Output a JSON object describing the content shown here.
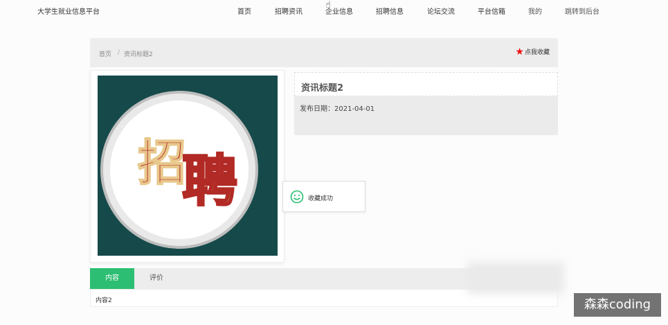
{
  "site": {
    "brand": "大学生就业信息平台"
  },
  "nav": {
    "items": [
      "首页",
      "招聘资讯",
      "企业信息",
      "招聘信息",
      "论坛交流",
      "平台信箱",
      "我的",
      "跳转到后台"
    ]
  },
  "breadcrumb": {
    "home": "首页",
    "separator": "/",
    "current": "资讯标题2"
  },
  "favorite": {
    "label": "点我收藏"
  },
  "poster": {
    "glyph1": "招",
    "glyph2": "聘"
  },
  "detail": {
    "title": "资讯标题2",
    "date_label": "发布日期：",
    "date": "2021-04-01"
  },
  "toast": {
    "message": "收藏成功"
  },
  "tabs": [
    {
      "label": "内容"
    },
    {
      "label": "评价"
    }
  ],
  "content": {
    "text": "内容2"
  },
  "watermark": {
    "text": "森森coding"
  },
  "colors": {
    "accent": "#2cbe72",
    "star": "#e11111",
    "poster_bg": "#16494a",
    "poster_text": "#b22a25"
  }
}
